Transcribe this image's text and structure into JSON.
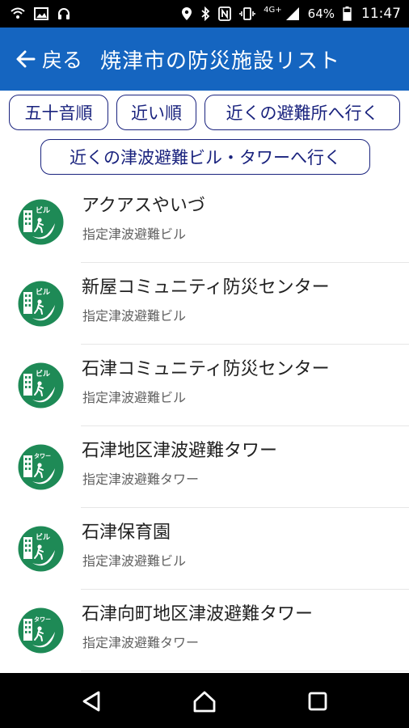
{
  "status_bar": {
    "network_type": "4G+",
    "battery": "64%",
    "time": "11:47"
  },
  "app_bar": {
    "back_label": "戻る",
    "title": "焼津市の防災施設リスト",
    "color": "#1565c0"
  },
  "sort_buttons": [
    "五十音順",
    "近い順",
    "近くの避難所へ行く",
    "近くの津波避難ビル・タワーへ行く"
  ],
  "facilities": [
    {
      "name": "アクアスやいづ",
      "type": "指定津波避難ビル",
      "badge": "ビル"
    },
    {
      "name": "新屋コミュニティ防災センター",
      "type": "指定津波避難ビル",
      "badge": "ビル"
    },
    {
      "name": "石津コミュニティ防災センター",
      "type": "指定津波避難ビル",
      "badge": "ビル"
    },
    {
      "name": "石津地区津波避難タワー",
      "type": "指定津波避難タワー",
      "badge": "タワー"
    },
    {
      "name": "石津保育園",
      "type": "指定津波避難ビル",
      "badge": "ビル"
    },
    {
      "name": "石津向町地区津波避難タワー",
      "type": "指定津波避難タワー",
      "badge": "タワー"
    }
  ],
  "icons": {
    "badge_color": "#1e8a56",
    "badge_icon": "tsunami-evacuation-building-icon"
  }
}
